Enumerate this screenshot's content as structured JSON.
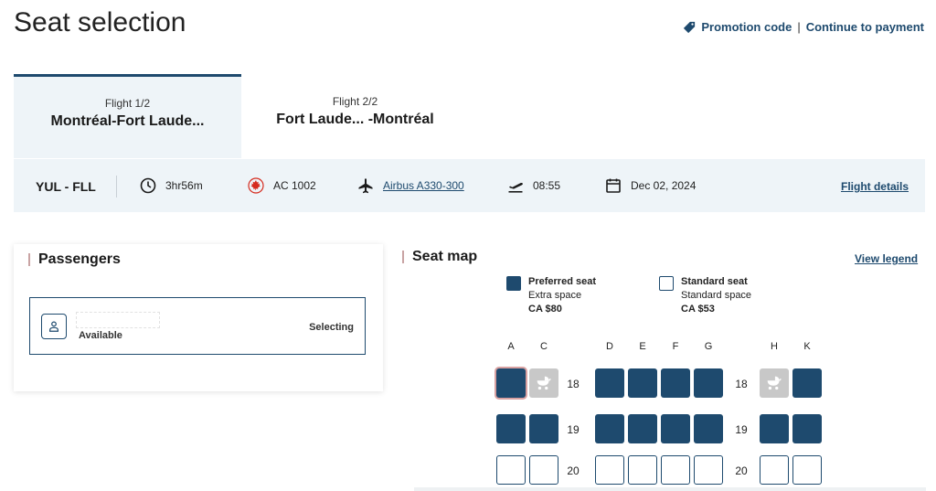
{
  "page": {
    "title": "Seat selection"
  },
  "top_links": {
    "promotion": "Promotion code",
    "separator": "|",
    "continue": "Continue to payment"
  },
  "tabs": [
    {
      "sub": "Flight 1/2",
      "route": "Montréal-Fort Laude...",
      "active": true
    },
    {
      "sub": "Flight 2/2",
      "route": "Fort Laude... -Montréal",
      "active": false
    }
  ],
  "flight_info": {
    "route_code": "YUL - FLL",
    "duration": "3hr56m",
    "flight_number": "AC 1002",
    "aircraft": "Airbus A330-300",
    "departure_time": "08:55",
    "date": "Dec 02, 2024",
    "details_link": "Flight details"
  },
  "passengers": {
    "title": "Passengers",
    "items": [
      {
        "name": "",
        "status": "Available",
        "action": "Selecting"
      }
    ]
  },
  "seat_map": {
    "title": "Seat map",
    "view_legend": "View legend",
    "legend": [
      {
        "type": "preferred",
        "name": "Preferred seat",
        "desc": "Extra space",
        "price": "CA $80"
      },
      {
        "type": "standard",
        "name": "Standard seat",
        "desc": "Standard space",
        "price": "CA $53"
      }
    ],
    "columns": [
      "A",
      "C",
      "D",
      "E",
      "F",
      "G",
      "H",
      "K"
    ],
    "rows": [
      {
        "number": "18",
        "seats": [
          "selected",
          "bassinet",
          "preferred",
          "preferred",
          "preferred",
          "preferred",
          "bassinet",
          "preferred"
        ]
      },
      {
        "number": "19",
        "seats": [
          "preferred",
          "preferred",
          "preferred",
          "preferred",
          "preferred",
          "preferred",
          "preferred",
          "preferred"
        ]
      },
      {
        "number": "20",
        "seats": [
          "standard",
          "standard",
          "standard",
          "standard",
          "standard",
          "standard",
          "standard",
          "standard"
        ]
      }
    ]
  },
  "colors": {
    "accent": "#1e4a6e",
    "panel_bg": "#eef4f8",
    "bassinet": "#c8c8c8",
    "maple_red": "#d52b1e"
  },
  "icons": {
    "promotion": "tag-icon",
    "duration": "clock-icon",
    "airline": "maple-leaf-icon",
    "aircraft": "plane-icon",
    "departure": "takeoff-icon",
    "date": "calendar-icon",
    "passenger": "person-icon",
    "bassinet": "bassinet-icon"
  }
}
